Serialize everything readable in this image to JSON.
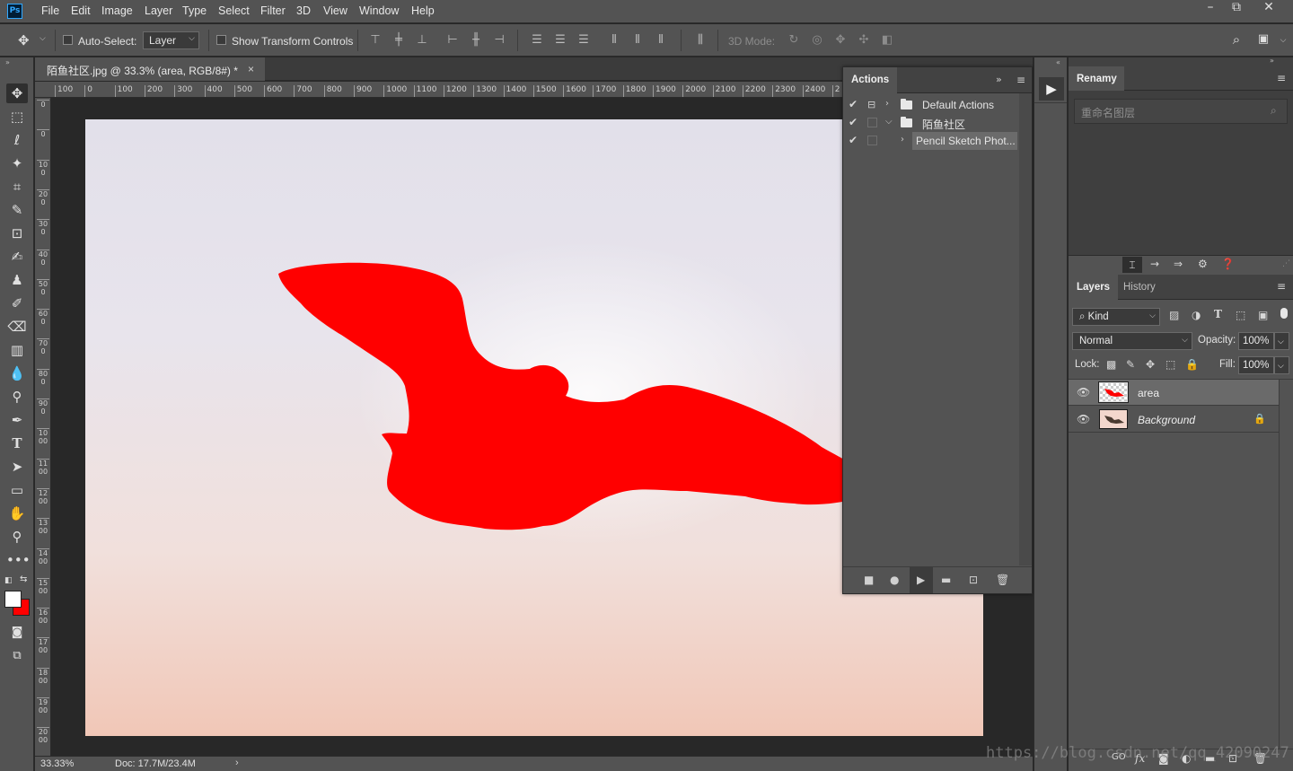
{
  "app": {
    "logo": "Ps"
  },
  "menu": [
    "File",
    "Edit",
    "Image",
    "Layer",
    "Type",
    "Select",
    "Filter",
    "3D",
    "View",
    "Window",
    "Help"
  ],
  "window_controls": {
    "minimize": "–",
    "restore": "⧉",
    "close": "✕"
  },
  "options_bar": {
    "auto_select_label": "Auto-Select:",
    "auto_select_target": "Layer",
    "show_transform_label": "Show Transform Controls",
    "mode_3d_label": "3D Mode:"
  },
  "document_tab": {
    "title": "陌鱼社区.jpg @ 33.3% (area, RGB/8#) *",
    "close": "×"
  },
  "ruler_top": [
    "100",
    "0",
    "100",
    "200",
    "300",
    "400",
    "500",
    "600",
    "700",
    "800",
    "900",
    "1000",
    "1100",
    "1200",
    "1300",
    "1400",
    "1500",
    "1600",
    "1700",
    "1800",
    "1900",
    "2000",
    "2100",
    "2200",
    "2300",
    "2400",
    "2"
  ],
  "ruler_left": [
    "0",
    "0",
    "100",
    "200",
    "300",
    "400",
    "500",
    "600",
    "700",
    "800",
    "900",
    "1000",
    "1100",
    "1200",
    "1300",
    "1400",
    "1500",
    "1600",
    "1700",
    "1800",
    "1900",
    "2000"
  ],
  "status": {
    "zoom": "33.33%",
    "doc": "Doc: 17.7M/23.4M",
    "arrow": "›"
  },
  "actions_panel": {
    "tab": "Actions",
    "rows": [
      {
        "checked": true,
        "label": "Default Actions",
        "type": "set",
        "expanded": false
      },
      {
        "checked": true,
        "label": "陌鱼社区",
        "type": "set",
        "expanded": true
      },
      {
        "checked": true,
        "label": "Pencil Sketch Phot...",
        "type": "action",
        "expanded": false
      }
    ]
  },
  "renamy_panel": {
    "tab": "Renamy",
    "search_placeholder": "重命名图层"
  },
  "layers_panel": {
    "tabs": [
      "Layers",
      "History"
    ],
    "filter_kind": "Kind",
    "blend_mode": "Normal",
    "opacity_label": "Opacity:",
    "opacity_value": "100%",
    "lock_label": "Lock:",
    "fill_label": "Fill:",
    "fill_value": "100%",
    "layers": [
      {
        "name": "area",
        "selected": true,
        "visible": true,
        "locked": false
      },
      {
        "name": "Background",
        "selected": false,
        "visible": true,
        "locked": true
      }
    ],
    "bottom_labels": {
      "fx": "fx",
      "link": "GO"
    }
  },
  "colors": {
    "foreground": "#ffffff",
    "background": "#ff0000",
    "selection_fill": "#ff0000",
    "ps_blue": "#31a8ff"
  },
  "watermark": "https://blog.csdn.net/qq_42090247"
}
